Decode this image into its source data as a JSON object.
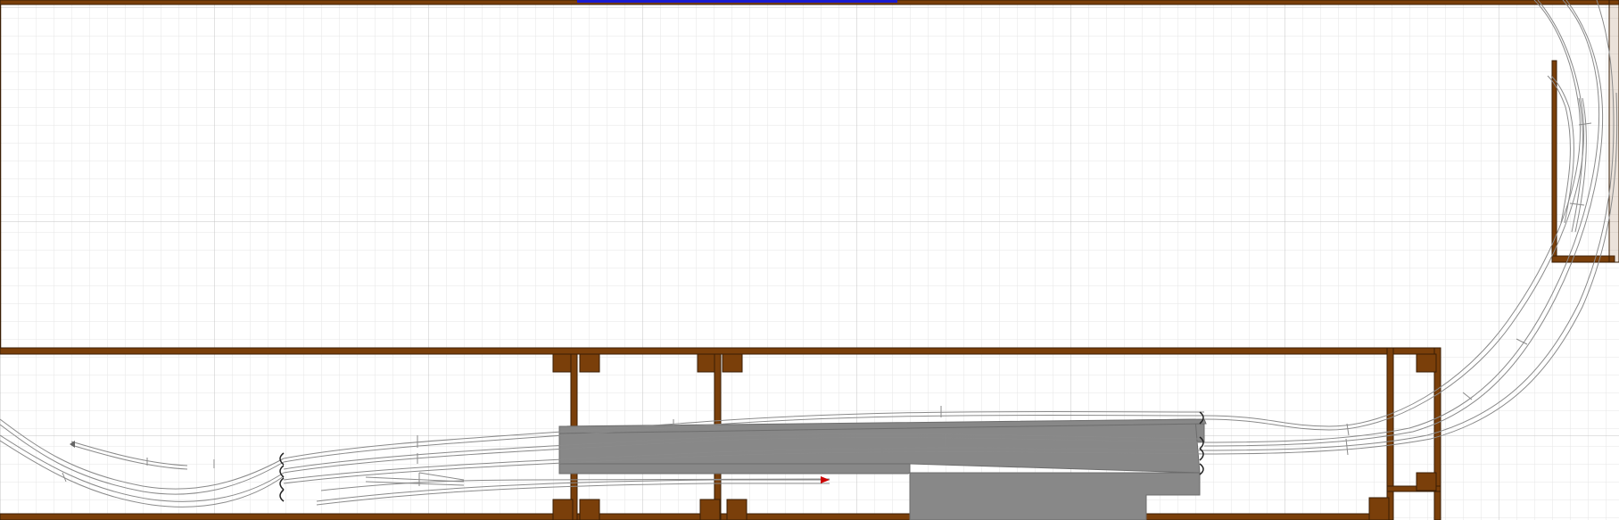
{
  "diagram": {
    "kind": "model railroad track plan",
    "grid": true,
    "colors": {
      "background": "#ffffff",
      "grid_minor": "#e3e3e3",
      "grid_major": "#c6c6c6",
      "benchwork": "#7a3f0a",
      "benchwork_edge": "#3a1e04",
      "wall_marker": "#1a1ad0",
      "track_rail": "#8a8a8a",
      "track_tie": "#c9c9c9",
      "platform": "#888888",
      "end_marker": "#cc0000"
    },
    "icons": [
      "bumper-stop-icon",
      "track-end-arrow-icon"
    ]
  }
}
